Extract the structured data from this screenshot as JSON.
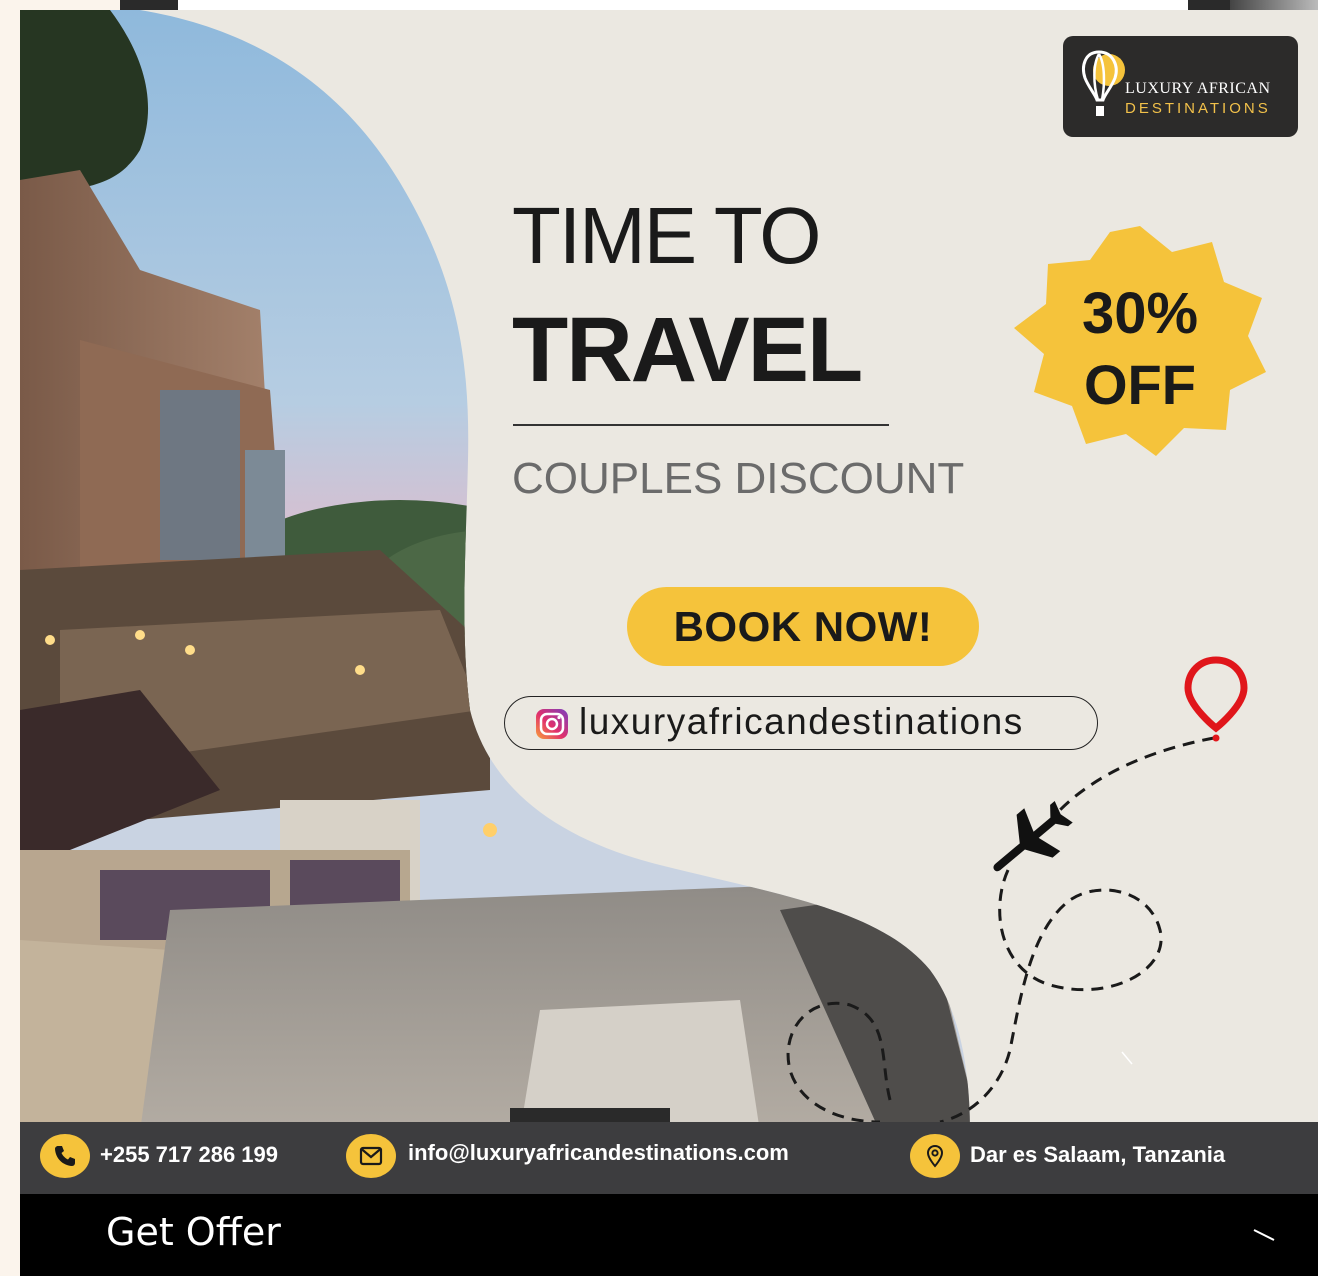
{
  "promo": {
    "brand_line1": "LUXURY AFRICAN",
    "brand_line2": "DESTINATIONS",
    "headline_1": "TIME TO",
    "headline_2": "TRAVEL",
    "subtitle": "COUPLES DISCOUNT",
    "discount_value": "30%",
    "discount_word": "OFF",
    "cta_label": "BOOK NOW!",
    "instagram_handle": "luxuryafricandestinations"
  },
  "contact": {
    "phone": "+255 717 286 199",
    "email": "info@luxuryafricandestinations.com",
    "location": "Dar es Salaam, Tanzania"
  },
  "offer_bar": {
    "label": "Get Offer"
  },
  "colors": {
    "accent_yellow": "#f5c33b",
    "background_beige": "#ebe8e1",
    "contact_bar": "#3d3d3f",
    "pin_red": "#e0161b"
  },
  "icons": [
    "balloon-logo-icon",
    "instagram-icon",
    "airplane-icon",
    "location-pin-icon",
    "phone-icon",
    "mail-icon",
    "map-pin-icon",
    "chevron-icon"
  ]
}
